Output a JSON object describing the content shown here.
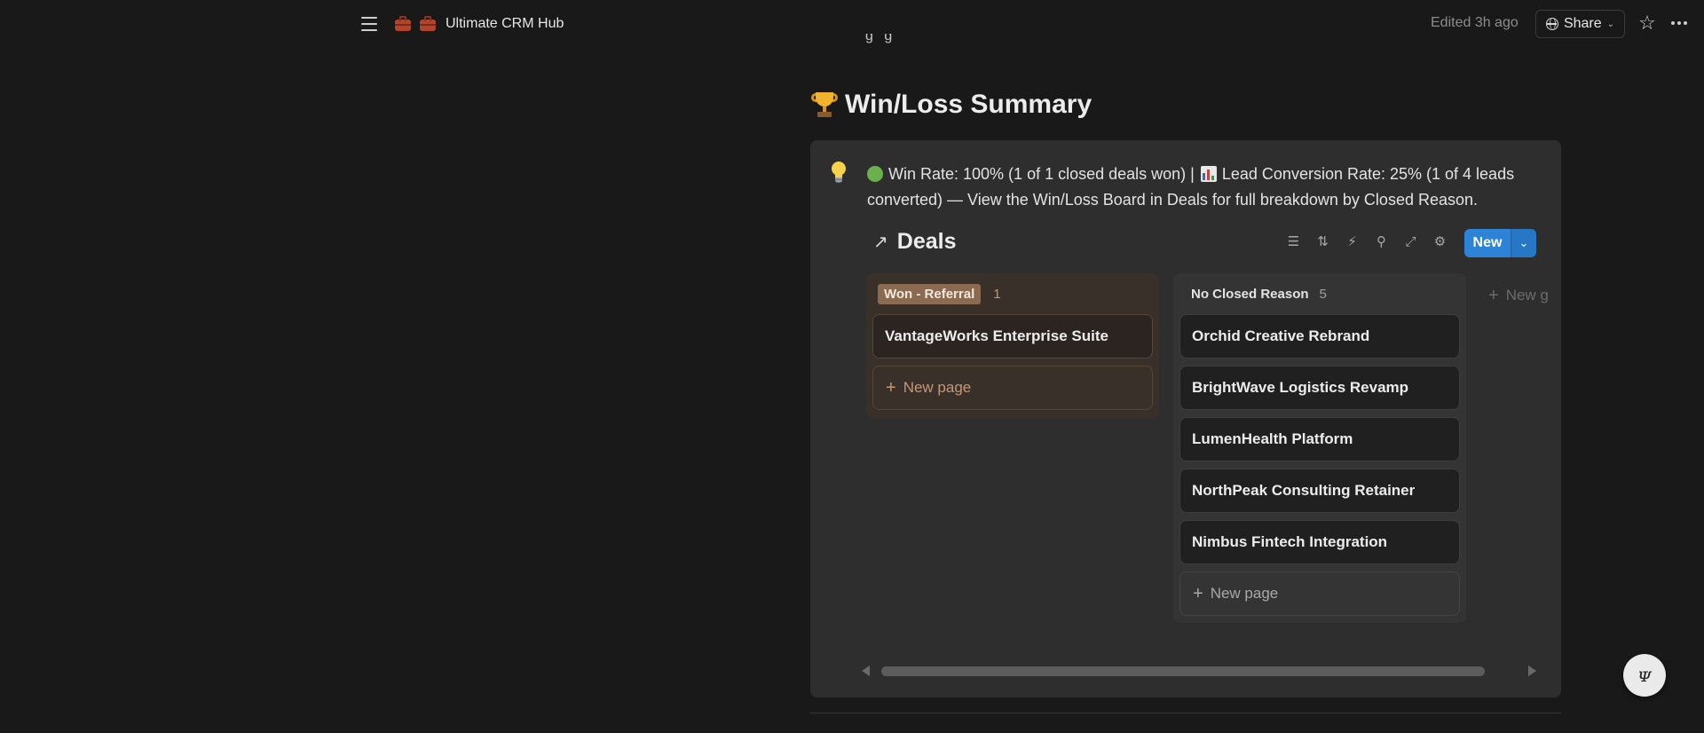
{
  "topbar": {
    "page_title": "Ultimate CRM Hub",
    "edited": "Edited 3h ago",
    "share_label": "Share"
  },
  "section": {
    "heading": "Win/Loss Summary"
  },
  "callout": {
    "part1": "Win Rate: 100% (1 of 1 closed deals won) |",
    "part2": "Lead Conversion Rate: 25% (1 of 4 leads converted) — View the Win/Loss Board in Deals for full breakdown by Closed Reason."
  },
  "board": {
    "title": "Deals",
    "new_label": "New",
    "columns": [
      {
        "label": "Won - Referral",
        "count": "1",
        "cards": [
          "VantageWorks Enterprise Suite"
        ],
        "new_page": "New page"
      },
      {
        "label": "No Closed Reason",
        "count": "5",
        "cards": [
          "Orchid Creative Rebrand",
          "BrightWave Logistics Revamp",
          "LumenHealth Platform",
          "NorthPeak Consulting Retainer",
          "Nimbus Fintech Integration"
        ],
        "new_page": "New page"
      }
    ],
    "new_group": "New g"
  },
  "colors": {
    "background": "#191919",
    "callout_bg": "#2e2e2e",
    "accent_blue": "#2d83d6",
    "won_tag": "#8a6a50"
  },
  "icons": [
    "menu-icon",
    "briefcase-icon",
    "globe-icon",
    "star-icon",
    "more-icon",
    "trophy-icon",
    "lightbulb-icon",
    "green-circle-icon",
    "bar-chart-icon",
    "arrow-link-icon",
    "filter-icon",
    "sort-icon",
    "lightning-icon",
    "search-icon",
    "expand-icon",
    "settings-icon",
    "plus-icon",
    "help-icon"
  ]
}
